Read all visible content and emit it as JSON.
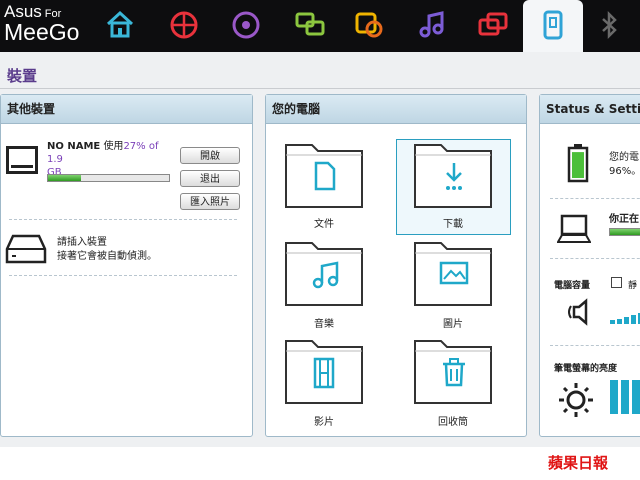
{
  "brand": {
    "line1": "Asus",
    "line1_small": "For",
    "line2": "MeeGo"
  },
  "tabs": [
    {
      "name": "home-icon",
      "color": "#3ab7d8"
    },
    {
      "name": "web-icon",
      "color": "#e8323c"
    },
    {
      "name": "media-icon",
      "color": "#9a58c8"
    },
    {
      "name": "chat-icon",
      "color": "#8cc63f"
    },
    {
      "name": "social-icon",
      "color": "#f0b400"
    },
    {
      "name": "music-icon",
      "color": "#7c5cd6"
    },
    {
      "name": "apps-icon",
      "color": "#e8323c"
    },
    {
      "name": "device-icon",
      "color": "#2fa3d6"
    },
    {
      "name": "bluetooth-icon",
      "color": "#6a6a6a"
    }
  ],
  "page_title": "裝置",
  "other_devices": {
    "header": "其他裝置",
    "device_name": "NO NAME",
    "usage_prefix": "使用",
    "usage_value": "27% of 1.9",
    "usage_unit": "GB",
    "usage_fraction": 0.27,
    "buttons": {
      "open": "開啟",
      "eject": "退出",
      "import": "匯入照片"
    },
    "insert_line1": "請插入裝置",
    "insert_line2": "接著它會被自動偵測。"
  },
  "my_computer": {
    "header": "您的電腦",
    "folders": [
      {
        "label": "文件",
        "icon": "document-icon"
      },
      {
        "label": "下載",
        "icon": "download-icon"
      },
      {
        "label": "音樂",
        "icon": "music-note-icon"
      },
      {
        "label": "圖片",
        "icon": "picture-icon"
      },
      {
        "label": "影片",
        "icon": "film-icon"
      },
      {
        "label": "回收筒",
        "icon": "trash-icon"
      }
    ]
  },
  "status": {
    "header": "Status & Setting",
    "battery_line1": "您的電",
    "battery_line2": "96%。",
    "battery_level": 0.96,
    "network_text": "你正在",
    "volume_label": "電腦容量",
    "mute_label": "靜",
    "brightness_label": "筆電螢幕的亮度"
  },
  "watermark": "蘋果日報",
  "colors": {
    "accent": "#2a9ec0",
    "title": "#5a3c8c",
    "usage": "#7a3fb8"
  }
}
